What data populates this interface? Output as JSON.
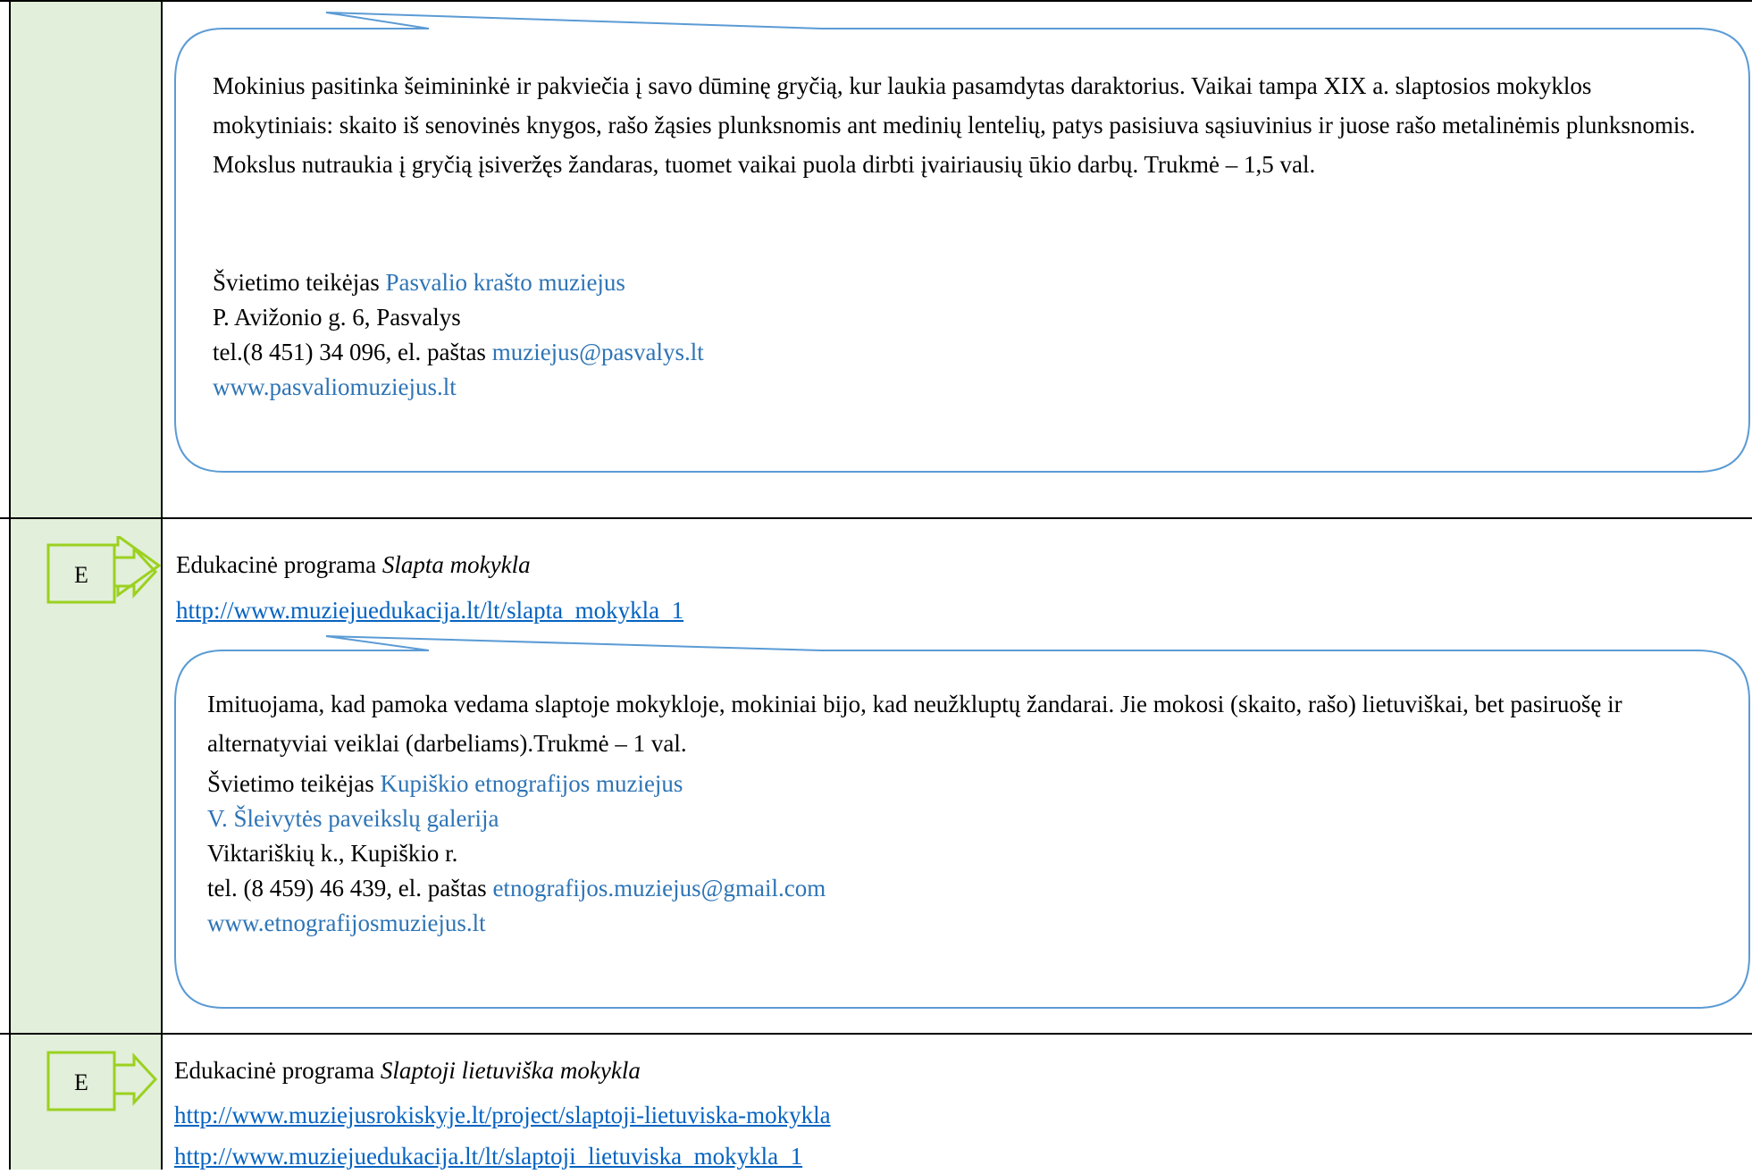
{
  "section1": {
    "description": "Mokinius pasitinka šeimininkė ir pakviečia į savo dūminę gryčią, kur laukia pasamdytas daraktorius. Vaikai tampa XIX a. slaptosios mokyklos mokytiniais: skaito iš senovinės knygos, rašo žąsies plunksnomis ant medinių lentelių, patys pasisiuva sąsiuvinius ir juose rašo metalinėmis plunksnomis. Mokslus nutraukia į gryčią įsiveržęs žandaras, tuomet vaikai puola dirbti įvairiausių ūkio darbų. Trukmė – 1,5 val.",
    "provider_label": "Švietimo teikėjas ",
    "provider_name": "Pasvalio krašto muziejus",
    "address": "P. Avižonio g. 6, Pasvalys",
    "phone_prefix": "tel.(8 451) 34 096, el. paštas ",
    "email": "muziejus@pasvalys.lt",
    "website": "www.pasvaliomuziejus.lt"
  },
  "section2": {
    "badge": "E",
    "program_prefix": "Edukacinė programa ",
    "program_title": "Slapta mokykla",
    "link": "http://www.muziejuedukacija.lt/lt/slapta_mokykla_1",
    "description": "Imituojama, kad pamoka vedama slaptoje mokykloje, mokiniai bijo, kad neužkluptų žandarai. Jie mokosi (skaito, rašo) lietuviškai, bet pasiruošę ir alternatyviai veiklai (darbeliams).Trukmė – 1 val.",
    "provider_label": "Švietimo teikėjas ",
    "provider_name": "Kupiškio etnografijos muziejus",
    "provider_sub": "V. Šleivytės paveikslų galerija",
    "address": "Viktariškių k., Kupiškio r.",
    "phone_prefix": "tel. (8 459) 46 439, el. paštas ",
    "email": "etnografijos.muziejus@gmail.com",
    "website": "www.etnografijosmuziejus.lt"
  },
  "section3": {
    "badge": "E",
    "program_prefix": "Edukacinė programa ",
    "program_title": "Slaptoji lietuviška mokykla",
    "link1": "http://www.muziejusrokiskyje.lt/project/slaptoji-lietuviska-mokykla",
    "link2": "http://www.muziejuedukacija.lt/lt/slaptoji_lietuviska_mokykla_1"
  },
  "colors": {
    "left_column": "#e2efda",
    "bubble_stroke": "#5b9bd5",
    "provider_blue": "#2e74b5",
    "link_blue": "#0563c1",
    "badge_fill": "#e2efda",
    "badge_stroke": "#9bd11f"
  },
  "icons": [
    "arrow-badge-icon"
  ]
}
